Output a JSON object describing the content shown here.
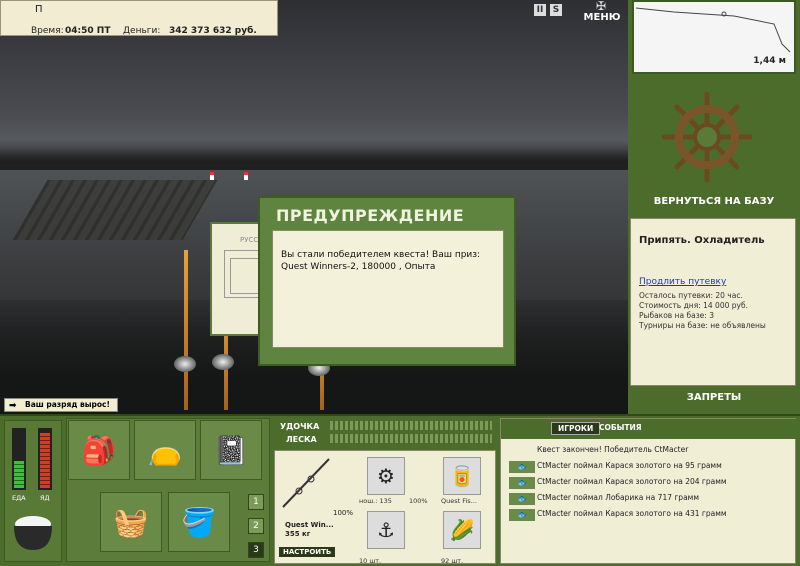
{
  "info": {
    "name": "П",
    "time_label": "Время:",
    "time_value": "04:50 ПТ",
    "money_label": "Деньги:",
    "money_value": "342 373 632 руб."
  },
  "topbar": {
    "pause": "II",
    "speed": "S",
    "menu": "МЕНЮ"
  },
  "depth": {
    "value": "1,44 м"
  },
  "base": {
    "back_button": "ВЕРНУТЬСЯ НА БАЗУ",
    "title": "Припять. Охладитель",
    "extend_link": "Продлить путевку",
    "remaining": "Осталось путевки: 20 час.",
    "day_cost": "Стоимость дня: 14 000 руб.",
    "anglers": "Рыбаков на базе: 3",
    "tournaments": "Турниры на базе: не объявлены",
    "bans_button": "ЗАПРЕТЫ"
  },
  "bg_dialog": {
    "label": "РУССК"
  },
  "warning": {
    "title": "ПРЕДУПРЕЖДЕНИЕ",
    "message": "Вы стали победителем квеста! Ваш приз: Quest Winners-2, 180000 , Опыта"
  },
  "rank": {
    "text": "Ваш разряд вырос!"
  },
  "meters": {
    "food_label": "ЕДА",
    "poison_label": "ЯД",
    "food_level": 0.45,
    "poison_level": 0.92
  },
  "inventory": {
    "pages": [
      "1",
      "2",
      "3"
    ],
    "active_page": "3"
  },
  "gear": {
    "rod_label": "УДОЧКА",
    "line_label": "ЛЕСКА",
    "rod_name": "Quest Win...",
    "rod_weight": "355 кг",
    "rod_condition": "100%",
    "reel_caption": "нош.: 135",
    "reel_condition": "100%",
    "bait_caption": "Quest Fis...",
    "hook_caption": "10 шт.",
    "groundbait_caption": "92 шт.",
    "tune_button": "НАСТРОИТЬ"
  },
  "events": {
    "tabs": [
      "ИГРОКИ",
      "СОБЫТИЯ"
    ],
    "quest_done": "Квест закончен! Победитель CtMacter",
    "catches": [
      "CtMacter поймал Карася золотого на 95 грамм",
      "CtMacter поймал Карася золотого на 204 грамм",
      "CtMacter поймал Лобарика на 717 грамм",
      "CtMacter поймал Карася золотого на 431 грамм"
    ]
  }
}
